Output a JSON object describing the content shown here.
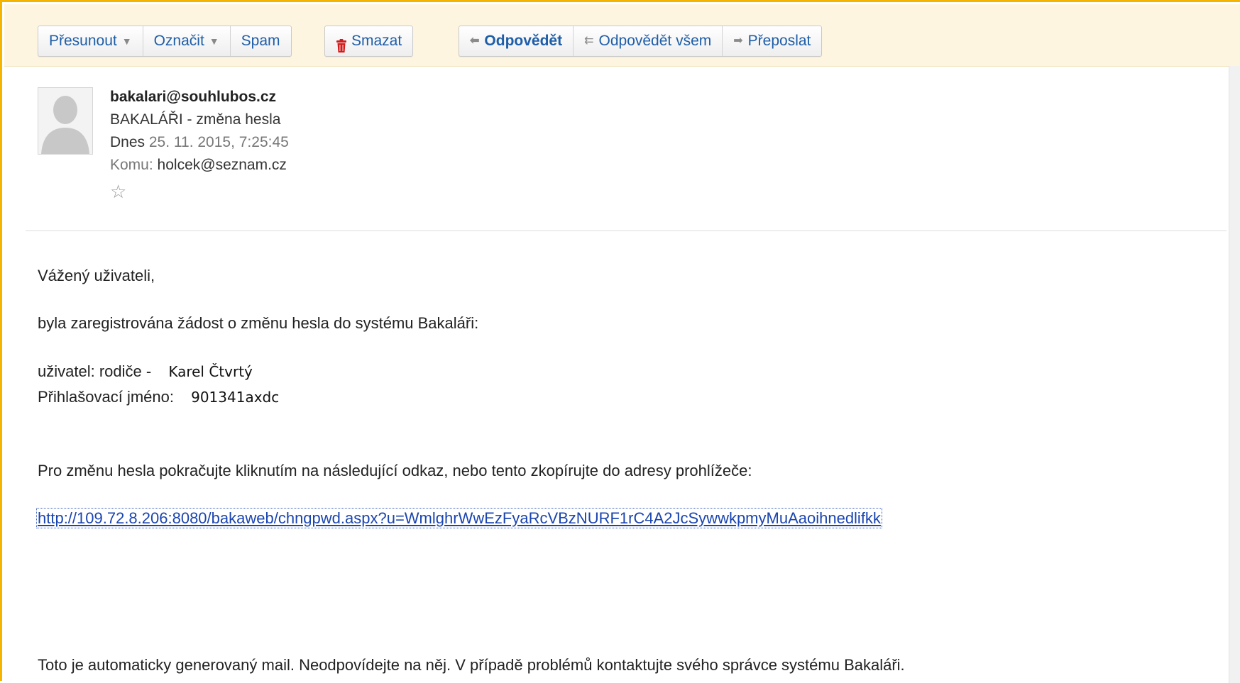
{
  "toolbar": {
    "move_label": "Přesunout",
    "mark_label": "Označit",
    "spam_label": "Spam",
    "delete_label": "Smazat",
    "reply_label": "Odpovědět",
    "reply_all_label": "Odpovědět všem",
    "forward_label": "Přeposlat"
  },
  "message": {
    "from": "bakalari@souhlubos.cz",
    "subject": "BAKALÁŘI - změna hesla",
    "date_prefix": "Dnes",
    "date": "25. 11. 2015, 7:25:45",
    "to_prefix": "Komu:",
    "to": "holcek@seznam.cz",
    "star_icon": "☆"
  },
  "body": {
    "greeting": "Vážený uživateli,",
    "intro": "byla zaregistrována žádost o změnu hesla do systému Bakaláři:",
    "user_label": "uživatel: rodiče -",
    "user_value": "Karel Čtvrtý",
    "login_label": "Přihlašovací jméno:",
    "login_value": "901341axdc",
    "instruction": "Pro změnu hesla pokračujte kliknutím na následující odkaz, nebo tento zkopírujte do adresy prohlížeče:",
    "link": "http://109.72.8.206:8080/bakaweb/chngpwd.aspx?u=WmlghrWwEzFyaRcVBzNURF1rC4A2JcSywwkpmyMuAaoihnedlifkk",
    "footer": "Toto je automaticky generovaný mail. Neodpovídejte na něj. V případě problémů kontaktujte svého správce systému Bakaláři."
  },
  "colors": {
    "accent_border": "#f5b400",
    "toolbar_bg": "#fdf5df",
    "button_text": "#1e5ea8",
    "delete_icon": "#d21b1b",
    "link": "#1a45b0"
  },
  "icons": {
    "move_caret": "chevron-down-icon",
    "mark_caret": "chevron-down-icon",
    "delete": "trash-icon",
    "reply": "reply-arrow-icon",
    "reply_all": "reply-all-arrow-icon",
    "forward": "forward-arrow-icon",
    "avatar": "default-avatar-icon",
    "star": "star-icon"
  }
}
